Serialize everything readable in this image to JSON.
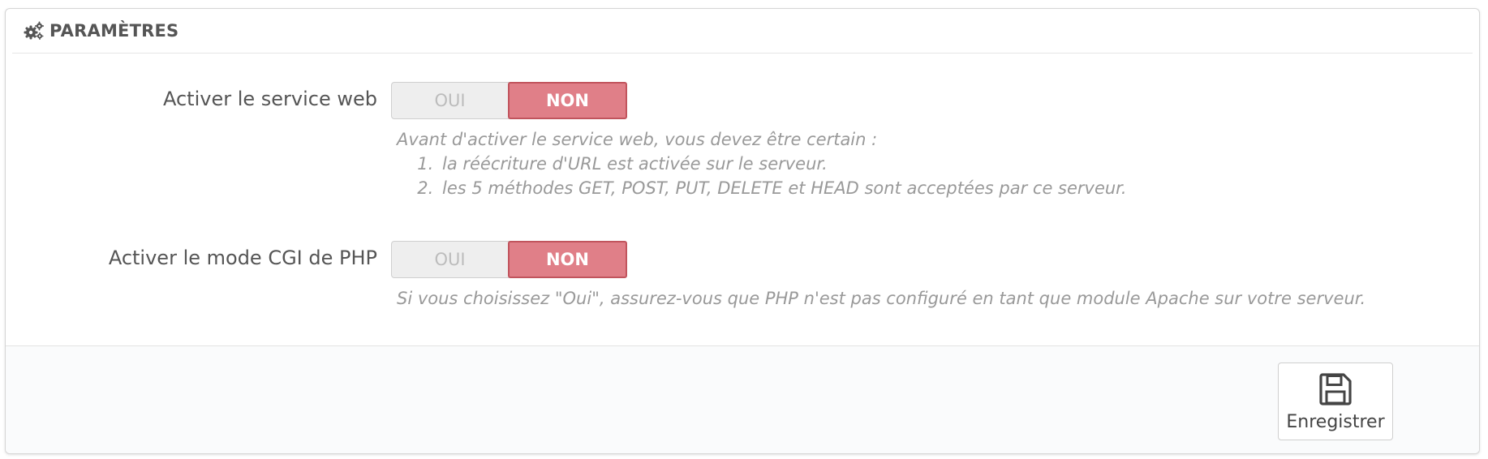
{
  "panel": {
    "title": "PARAMÈTRES",
    "heading_icon": "gears-icon"
  },
  "rows": [
    {
      "label": "Activer le service web",
      "switch": {
        "yes_label": "OUI",
        "no_label": "NON",
        "selected": "NON"
      },
      "help_intro": "Avant d'activer le service web, vous devez être certain :",
      "help_items": [
        "la réécriture d'URL est activée sur le serveur.",
        "les 5 méthodes GET, POST, PUT, DELETE et HEAD sont acceptées par ce serveur."
      ]
    },
    {
      "label": "Activer le mode CGI de PHP",
      "switch": {
        "yes_label": "OUI",
        "no_label": "NON",
        "selected": "NON"
      },
      "help_intro": "Si vous choisissez \"Oui\", assurez-vous que PHP n'est pas configuré en tant que module Apache sur votre serveur."
    }
  ],
  "footer": {
    "save_label": "Enregistrer",
    "save_icon": "floppy-disk-icon"
  },
  "colors": {
    "switch_active": "#e07f88",
    "switch_active_border": "#c1545d",
    "help_text": "#999999"
  }
}
